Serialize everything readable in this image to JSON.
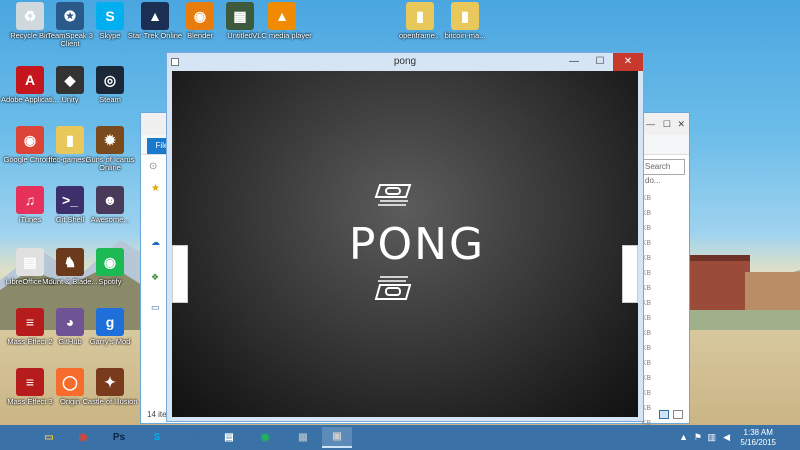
{
  "desktop": {
    "icons": [
      {
        "label": "Recycle Bin",
        "color": "#cfd8dc",
        "glyph": "♻"
      },
      {
        "label": "TeamSpeak 3 Client",
        "color": "#2a5a8a",
        "glyph": "✪"
      },
      {
        "label": "Skype",
        "color": "#00aff0",
        "glyph": "S"
      },
      {
        "label": "Star Trek Online",
        "color": "#1b2f55",
        "glyph": "▲"
      },
      {
        "label": "Blender",
        "color": "#e87d0d",
        "glyph": "◉"
      },
      {
        "label": "Untitled",
        "color": "#3d5a3c",
        "glyph": "▦"
      },
      {
        "label": "VLC media player",
        "color": "#f08a00",
        "glyph": "▲"
      },
      {
        "label": "openframe...",
        "color": "#e8c85a",
        "glyph": "▮"
      },
      {
        "label": "bitcoin-ma...",
        "color": "#e8c85a",
        "glyph": "▮"
      },
      {
        "label": "Adobe Applicati...",
        "color": "#c4161c",
        "glyph": "A"
      },
      {
        "label": "Unity",
        "color": "#333333",
        "glyph": "◆"
      },
      {
        "label": "Steam",
        "color": "#1b2838",
        "glyph": "◎"
      },
      {
        "label": "Google Chrome",
        "color": "#db4437",
        "glyph": "◉"
      },
      {
        "label": "ffcc-games...",
        "color": "#e8c85a",
        "glyph": "▮"
      },
      {
        "label": "Guns of Icarus Online",
        "color": "#7a4a1c",
        "glyph": "✹"
      },
      {
        "label": "iTunes",
        "color": "#e6325a",
        "glyph": "♫"
      },
      {
        "label": "Git Shell",
        "color": "#3c2f6b",
        "glyph": ">_"
      },
      {
        "label": "Awesome...",
        "color": "#4a3a5a",
        "glyph": "☻"
      },
      {
        "label": "LibreOffice 4.3",
        "color": "#e0e0e0",
        "glyph": "▤"
      },
      {
        "label": "Mount & Blade...",
        "color": "#6b3a1c",
        "glyph": "♞"
      },
      {
        "label": "Spotify",
        "color": "#1db954",
        "glyph": "◉"
      },
      {
        "label": "Mass Effect 2",
        "color": "#b71c1c",
        "glyph": "≡"
      },
      {
        "label": "GitHub",
        "color": "#6e5494",
        "glyph": "◕"
      },
      {
        "label": "Garry's Mod",
        "color": "#1e6fd9",
        "glyph": "g"
      },
      {
        "label": "Mass Effect 3",
        "color": "#b71c1c",
        "glyph": "≡"
      },
      {
        "label": "Origin",
        "color": "#f56c2d",
        "glyph": "◯"
      },
      {
        "label": "Castle of Illusion",
        "color": "#7a3a1c",
        "glyph": "✦"
      }
    ]
  },
  "explorer": {
    "file_tab": "File",
    "search_placeholder": "Search do...",
    "size_unit": "KB",
    "status": "14 ite",
    "row_count": 16
  },
  "pong_window": {
    "title": "pong",
    "minimize": "—",
    "maximize": "☐",
    "close": "✕",
    "game_logo": "PONG"
  },
  "taskbar": {
    "items": [
      {
        "name": "file-explorer",
        "glyph": "▭",
        "color": "#f0c040"
      },
      {
        "name": "chrome",
        "glyph": "◉",
        "color": "#db4437"
      },
      {
        "name": "photoshop",
        "glyph": "Ps",
        "color": "#0b2545"
      },
      {
        "name": "skype",
        "glyph": "S",
        "color": "#00aff0"
      },
      {
        "name": "sync",
        "glyph": "⟳",
        "color": "#3a6ea5"
      },
      {
        "name": "document",
        "glyph": "▤",
        "color": "#ffffff"
      },
      {
        "name": "spotify",
        "glyph": "◉",
        "color": "#1db954"
      },
      {
        "name": "image-viewer",
        "glyph": "▦",
        "color": "#9fb5c8"
      },
      {
        "name": "pong",
        "glyph": "▣",
        "color": "#cccccc"
      }
    ],
    "time": "1:38 AM",
    "date": "5/16/2015"
  }
}
